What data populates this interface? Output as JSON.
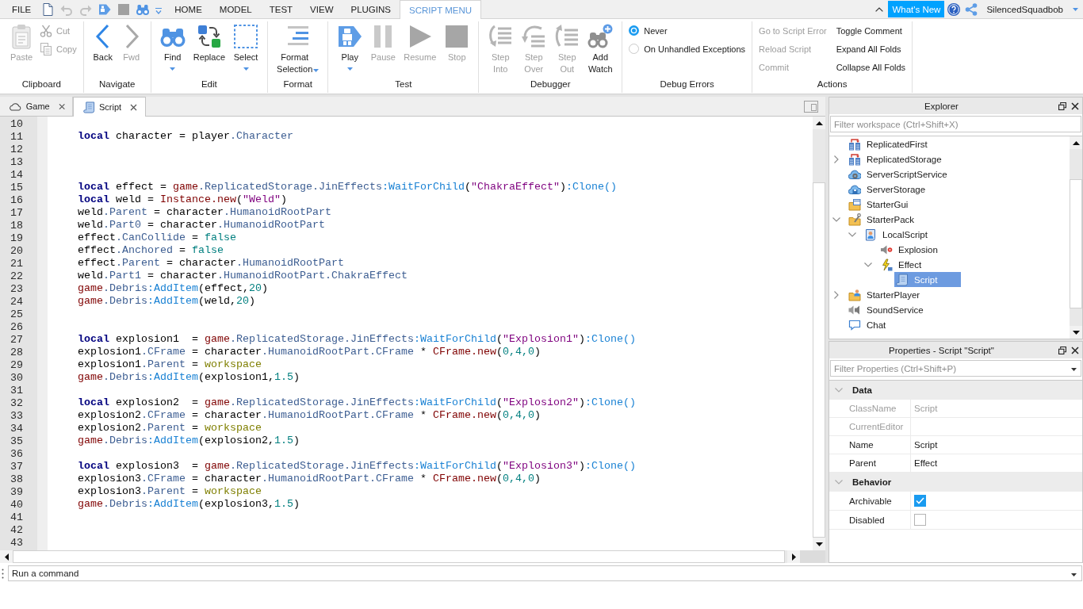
{
  "menu_bar": {
    "file": "FILE",
    "quick_access": [
      {
        "kind": "new",
        "disabled": false
      },
      {
        "kind": "undo",
        "disabled": true
      },
      {
        "kind": "redo",
        "disabled": true
      },
      {
        "kind": "play",
        "disabled": false
      },
      {
        "kind": "stop",
        "disabled": false
      },
      {
        "kind": "find",
        "disabled": false
      },
      {
        "kind": "more",
        "disabled": false
      }
    ],
    "tabs": [
      {
        "label": "HOME",
        "selected": false
      },
      {
        "label": "MODEL",
        "selected": false
      },
      {
        "label": "TEST",
        "selected": false
      },
      {
        "label": "VIEW",
        "selected": false
      },
      {
        "label": "PLUGINS",
        "selected": false
      },
      {
        "label": "SCRIPT MENU",
        "selected": true
      }
    ],
    "whats_new": "What's New",
    "user": "SilencedSquadbob"
  },
  "ribbon": {
    "groups": [
      {
        "label": "Clipboard",
        "items": [
          {
            "kind": "paste",
            "label": "Paste",
            "disabled": true
          },
          {
            "kind": "cut",
            "label": "Cut",
            "disabled": true
          },
          {
            "kind": "copy",
            "label": "Copy",
            "disabled": true
          }
        ]
      },
      {
        "label": "Navigate",
        "items": [
          {
            "kind": "back",
            "label": "Back",
            "disabled": false
          },
          {
            "kind": "forward",
            "label": "Fwd",
            "disabled": true
          }
        ]
      },
      {
        "label": "Edit",
        "items": [
          {
            "kind": "find",
            "label": "Find",
            "disabled": false,
            "dropdown": true
          },
          {
            "kind": "replace",
            "label": "Replace",
            "disabled": false
          },
          {
            "kind": "select",
            "label": "Select",
            "disabled": false,
            "dropdown": true
          }
        ]
      },
      {
        "label": "Format",
        "items": [
          {
            "kind": "format",
            "label": "Format Selection",
            "disabled": false,
            "dropdown": true
          }
        ]
      },
      {
        "label": "Test",
        "items": [
          {
            "kind": "play",
            "label": "Play",
            "disabled": false,
            "dropdown": true
          },
          {
            "kind": "pause",
            "label": "Pause",
            "disabled": true
          },
          {
            "kind": "resume",
            "label": "Resume",
            "disabled": true
          },
          {
            "kind": "stop",
            "label": "Stop",
            "disabled": true
          }
        ]
      },
      {
        "label": "Debugger",
        "items": [
          {
            "kind": "stepinto",
            "label": "Step Into",
            "disabled": true
          },
          {
            "kind": "stepover",
            "label": "Step Over",
            "disabled": true
          },
          {
            "kind": "stepout",
            "label": "Step Out",
            "disabled": true
          },
          {
            "kind": "watch",
            "label": "Add Watch",
            "disabled": false
          }
        ]
      },
      {
        "label": "Debug Errors",
        "items": [
          {
            "kind": "radio",
            "label": "Never",
            "selected": true
          },
          {
            "kind": "radio",
            "label": "On Unhandled Exceptions",
            "selected": false
          }
        ]
      },
      {
        "label": "Actions",
        "items": [
          {
            "kind": "command",
            "label": "Go to Script Error",
            "disabled": true
          },
          {
            "kind": "command",
            "label": "Reload Script",
            "disabled": true
          },
          {
            "kind": "command",
            "label": "Commit",
            "disabled": true
          },
          {
            "kind": "command",
            "label": "Toggle Comment",
            "disabled": false
          },
          {
            "kind": "command",
            "label": "Expand All Folds",
            "disabled": false
          },
          {
            "kind": "command",
            "label": "Collapse All Folds",
            "disabled": false
          }
        ]
      }
    ]
  },
  "document_tabs": [
    {
      "label": "Game",
      "kind": "place",
      "selected": false
    },
    {
      "label": "Script",
      "kind": "script",
      "selected": true
    }
  ],
  "editor": {
    "lines": [
      {
        "number": "10"
      },
      {
        "number": "11",
        "tokens": [
          {
            "kind": "keyword",
            "text": "local"
          },
          {
            "kind": "plain",
            "text": " character = player"
          },
          {
            "kind": "property",
            "text": ".Character"
          }
        ]
      },
      {
        "number": "12"
      },
      {
        "number": "13"
      },
      {
        "number": "14"
      },
      {
        "number": "15",
        "tokens": [
          {
            "kind": "keyword",
            "text": "local"
          },
          {
            "kind": "plain",
            "text": " effect = "
          },
          {
            "kind": "global",
            "text": "game"
          },
          {
            "kind": "property",
            "text": ".ReplicatedStorage.JinEffects"
          },
          {
            "kind": "method",
            "text": ":WaitForChild"
          },
          {
            "kind": "plain",
            "text": "("
          },
          {
            "kind": "string",
            "text": "\"ChakraEffect\""
          },
          {
            "kind": "plain",
            "text": ")"
          },
          {
            "kind": "method",
            "text": ":Clone()"
          }
        ]
      },
      {
        "number": "16",
        "tokens": [
          {
            "kind": "keyword",
            "text": "local"
          },
          {
            "kind": "plain",
            "text": " weld = "
          },
          {
            "kind": "global",
            "text": "Instance.new"
          },
          {
            "kind": "plain",
            "text": "("
          },
          {
            "kind": "string",
            "text": "\"Weld\""
          },
          {
            "kind": "plain",
            "text": ")"
          }
        ]
      },
      {
        "number": "17",
        "tokens": [
          {
            "kind": "plain",
            "text": "weld"
          },
          {
            "kind": "property",
            "text": ".Parent"
          },
          {
            "kind": "plain",
            "text": " = character"
          },
          {
            "kind": "property",
            "text": ".HumanoidRootPart"
          }
        ]
      },
      {
        "number": "18",
        "tokens": [
          {
            "kind": "plain",
            "text": "weld"
          },
          {
            "kind": "property",
            "text": ".Part0"
          },
          {
            "kind": "plain",
            "text": " = character"
          },
          {
            "kind": "property",
            "text": ".HumanoidRootPart"
          }
        ]
      },
      {
        "number": "19",
        "tokens": [
          {
            "kind": "plain",
            "text": "effect"
          },
          {
            "kind": "property",
            "text": ".CanCollide"
          },
          {
            "kind": "plain",
            "text": " = "
          },
          {
            "kind": "number",
            "text": "false"
          }
        ]
      },
      {
        "number": "20",
        "tokens": [
          {
            "kind": "plain",
            "text": "effect"
          },
          {
            "kind": "property",
            "text": ".Anchored"
          },
          {
            "kind": "plain",
            "text": " = "
          },
          {
            "kind": "number",
            "text": "false"
          }
        ]
      },
      {
        "number": "21",
        "tokens": [
          {
            "kind": "plain",
            "text": "effect"
          },
          {
            "kind": "property",
            "text": ".Parent"
          },
          {
            "kind": "plain",
            "text": " = character"
          },
          {
            "kind": "property",
            "text": ".HumanoidRootPart"
          }
        ]
      },
      {
        "number": "22",
        "tokens": [
          {
            "kind": "plain",
            "text": "weld"
          },
          {
            "kind": "property",
            "text": ".Part1"
          },
          {
            "kind": "plain",
            "text": " = character"
          },
          {
            "kind": "property",
            "text": ".HumanoidRootPart.ChakraEffect"
          }
        ]
      },
      {
        "number": "23",
        "tokens": [
          {
            "kind": "global",
            "text": "game"
          },
          {
            "kind": "property",
            "text": ".Debris"
          },
          {
            "kind": "method",
            "text": ":AddItem"
          },
          {
            "kind": "plain",
            "text": "(effect,"
          },
          {
            "kind": "number",
            "text": "20"
          },
          {
            "kind": "plain",
            "text": ")"
          }
        ]
      },
      {
        "number": "24",
        "tokens": [
          {
            "kind": "global",
            "text": "game"
          },
          {
            "kind": "property",
            "text": ".Debris"
          },
          {
            "kind": "method",
            "text": ":AddItem"
          },
          {
            "kind": "plain",
            "text": "(weld,"
          },
          {
            "kind": "number",
            "text": "20"
          },
          {
            "kind": "plain",
            "text": ")"
          }
        ]
      },
      {
        "number": "25"
      },
      {
        "number": "26"
      },
      {
        "number": "27",
        "tokens": [
          {
            "kind": "keyword",
            "text": "local"
          },
          {
            "kind": "plain",
            "text": " explosion1  = "
          },
          {
            "kind": "global",
            "text": "game"
          },
          {
            "kind": "property",
            "text": ".ReplicatedStorage.JinEffects"
          },
          {
            "kind": "method",
            "text": ":WaitForChild"
          },
          {
            "kind": "plain",
            "text": "("
          },
          {
            "kind": "string",
            "text": "\"Explosion1\""
          },
          {
            "kind": "plain",
            "text": ")"
          },
          {
            "kind": "method",
            "text": ":Clone()"
          }
        ]
      },
      {
        "number": "28",
        "tokens": [
          {
            "kind": "plain",
            "text": "explosion1"
          },
          {
            "kind": "property",
            "text": ".CFrame"
          },
          {
            "kind": "plain",
            "text": " = character"
          },
          {
            "kind": "property",
            "text": ".HumanoidRootPart.CFrame"
          },
          {
            "kind": "plain",
            "text": " * "
          },
          {
            "kind": "global",
            "text": "CFrame.new"
          },
          {
            "kind": "plain",
            "text": "("
          },
          {
            "kind": "number",
            "text": "0,4,0"
          },
          {
            "kind": "plain",
            "text": ")"
          }
        ]
      },
      {
        "number": "29",
        "tokens": [
          {
            "kind": "plain",
            "text": "explosion1"
          },
          {
            "kind": "property",
            "text": ".Parent"
          },
          {
            "kind": "plain",
            "text": " = "
          },
          {
            "kind": "builtin",
            "text": "workspace"
          }
        ]
      },
      {
        "number": "30",
        "tokens": [
          {
            "kind": "global",
            "text": "game"
          },
          {
            "kind": "property",
            "text": ".Debris"
          },
          {
            "kind": "method",
            "text": ":AddItem"
          },
          {
            "kind": "plain",
            "text": "(explosion1,"
          },
          {
            "kind": "number",
            "text": "1.5"
          },
          {
            "kind": "plain",
            "text": ")"
          }
        ]
      },
      {
        "number": "31"
      },
      {
        "number": "32",
        "tokens": [
          {
            "kind": "keyword",
            "text": "local"
          },
          {
            "kind": "plain",
            "text": " explosion2  = "
          },
          {
            "kind": "global",
            "text": "game"
          },
          {
            "kind": "property",
            "text": ".ReplicatedStorage.JinEffects"
          },
          {
            "kind": "method",
            "text": ":WaitForChild"
          },
          {
            "kind": "plain",
            "text": "("
          },
          {
            "kind": "string",
            "text": "\"Explosion2\""
          },
          {
            "kind": "plain",
            "text": ")"
          },
          {
            "kind": "method",
            "text": ":Clone()"
          }
        ]
      },
      {
        "number": "33",
        "tokens": [
          {
            "kind": "plain",
            "text": "explosion2"
          },
          {
            "kind": "property",
            "text": ".CFrame"
          },
          {
            "kind": "plain",
            "text": " = character"
          },
          {
            "kind": "property",
            "text": ".HumanoidRootPart.CFrame"
          },
          {
            "kind": "plain",
            "text": " * "
          },
          {
            "kind": "global",
            "text": "CFrame.new"
          },
          {
            "kind": "plain",
            "text": "("
          },
          {
            "kind": "number",
            "text": "0,4,0"
          },
          {
            "kind": "plain",
            "text": ")"
          }
        ]
      },
      {
        "number": "34",
        "tokens": [
          {
            "kind": "plain",
            "text": "explosion2"
          },
          {
            "kind": "property",
            "text": ".Parent"
          },
          {
            "kind": "plain",
            "text": " = "
          },
          {
            "kind": "builtin",
            "text": "workspace"
          }
        ]
      },
      {
        "number": "35",
        "tokens": [
          {
            "kind": "global",
            "text": "game"
          },
          {
            "kind": "property",
            "text": ".Debris"
          },
          {
            "kind": "method",
            "text": ":AddItem"
          },
          {
            "kind": "plain",
            "text": "(explosion2,"
          },
          {
            "kind": "number",
            "text": "1.5"
          },
          {
            "kind": "plain",
            "text": ")"
          }
        ]
      },
      {
        "number": "36"
      },
      {
        "number": "37",
        "tokens": [
          {
            "kind": "keyword",
            "text": "local"
          },
          {
            "kind": "plain",
            "text": " explosion3  = "
          },
          {
            "kind": "global",
            "text": "game"
          },
          {
            "kind": "property",
            "text": ".ReplicatedStorage.JinEffects"
          },
          {
            "kind": "method",
            "text": ":WaitForChild"
          },
          {
            "kind": "plain",
            "text": "("
          },
          {
            "kind": "string",
            "text": "\"Explosion3\""
          },
          {
            "kind": "plain",
            "text": ")"
          },
          {
            "kind": "method",
            "text": ":Clone()"
          }
        ]
      },
      {
        "number": "38",
        "tokens": [
          {
            "kind": "plain",
            "text": "explosion3"
          },
          {
            "kind": "property",
            "text": ".CFrame"
          },
          {
            "kind": "plain",
            "text": " = character"
          },
          {
            "kind": "property",
            "text": ".HumanoidRootPart.CFrame"
          },
          {
            "kind": "plain",
            "text": " * "
          },
          {
            "kind": "global",
            "text": "CFrame.new"
          },
          {
            "kind": "plain",
            "text": "("
          },
          {
            "kind": "number",
            "text": "0,4,0"
          },
          {
            "kind": "plain",
            "text": ")"
          }
        ]
      },
      {
        "number": "39",
        "tokens": [
          {
            "kind": "plain",
            "text": "explosion3"
          },
          {
            "kind": "property",
            "text": ".Parent"
          },
          {
            "kind": "plain",
            "text": " = "
          },
          {
            "kind": "builtin",
            "text": "workspace"
          }
        ]
      },
      {
        "number": "40",
        "tokens": [
          {
            "kind": "global",
            "text": "game"
          },
          {
            "kind": "property",
            "text": ".Debris"
          },
          {
            "kind": "method",
            "text": ":AddItem"
          },
          {
            "kind": "plain",
            "text": "(explosion3,"
          },
          {
            "kind": "number",
            "text": "1.5"
          },
          {
            "kind": "plain",
            "text": ")"
          }
        ]
      },
      {
        "number": "41"
      },
      {
        "number": "42"
      },
      {
        "number": "43"
      }
    ]
  },
  "explorer": {
    "title": "Explorer",
    "filter_placeholder": "Filter workspace (Ctrl+Shift+X)",
    "items": [
      {
        "label": "ReplicatedFirst",
        "kind": "replicated",
        "selected": false
      },
      {
        "label": "ReplicatedStorage",
        "kind": "replicated",
        "expanded": false,
        "selected": false
      },
      {
        "label": "ServerScriptService",
        "kind": "scriptservice",
        "selected": false
      },
      {
        "label": "ServerStorage",
        "kind": "storage",
        "selected": false
      },
      {
        "label": "StarterGui",
        "kind": "gui",
        "selected": false
      },
      {
        "label": "StarterPack",
        "kind": "pack",
        "expanded": true,
        "selected": false,
        "children": [
          {
            "label": "LocalScript",
            "kind": "localscript",
            "expanded": true,
            "selected": false,
            "children": [
              {
                "label": "Explosion",
                "kind": "explosion",
                "selected": false
              },
              {
                "label": "Effect",
                "kind": "effect",
                "expanded": true,
                "selected": false,
                "children": [
                  {
                    "label": "Script",
                    "kind": "script",
                    "selected": true
                  }
                ]
              }
            ]
          }
        ]
      },
      {
        "label": "StarterPlayer",
        "kind": "player",
        "expanded": false,
        "selected": false
      },
      {
        "label": "SoundService",
        "kind": "sound",
        "selected": false
      },
      {
        "label": "Chat",
        "kind": "chat",
        "selected": false
      }
    ]
  },
  "properties": {
    "title": "Properties - Script \"Script\"",
    "filter_placeholder": "Filter Properties (Ctrl+Shift+P)",
    "sections": [
      {
        "label": "Data",
        "expanded": true,
        "rows": [
          {
            "name": "ClassName",
            "kind": "text",
            "value": "Script",
            "disabled": true
          },
          {
            "name": "CurrentEditor",
            "kind": "text",
            "disabled": true
          },
          {
            "name": "Name",
            "kind": "text",
            "value": "Script",
            "disabled": false
          },
          {
            "name": "Parent",
            "kind": "text",
            "value": "Effect",
            "disabled": false
          }
        ]
      },
      {
        "label": "Behavior",
        "expanded": true,
        "rows": [
          {
            "name": "Archivable",
            "kind": "checkbox",
            "checked": true
          },
          {
            "name": "Disabled",
            "kind": "checkbox",
            "checked": false
          }
        ]
      }
    ]
  },
  "command_bar": {
    "placeholder": "Run a command"
  }
}
